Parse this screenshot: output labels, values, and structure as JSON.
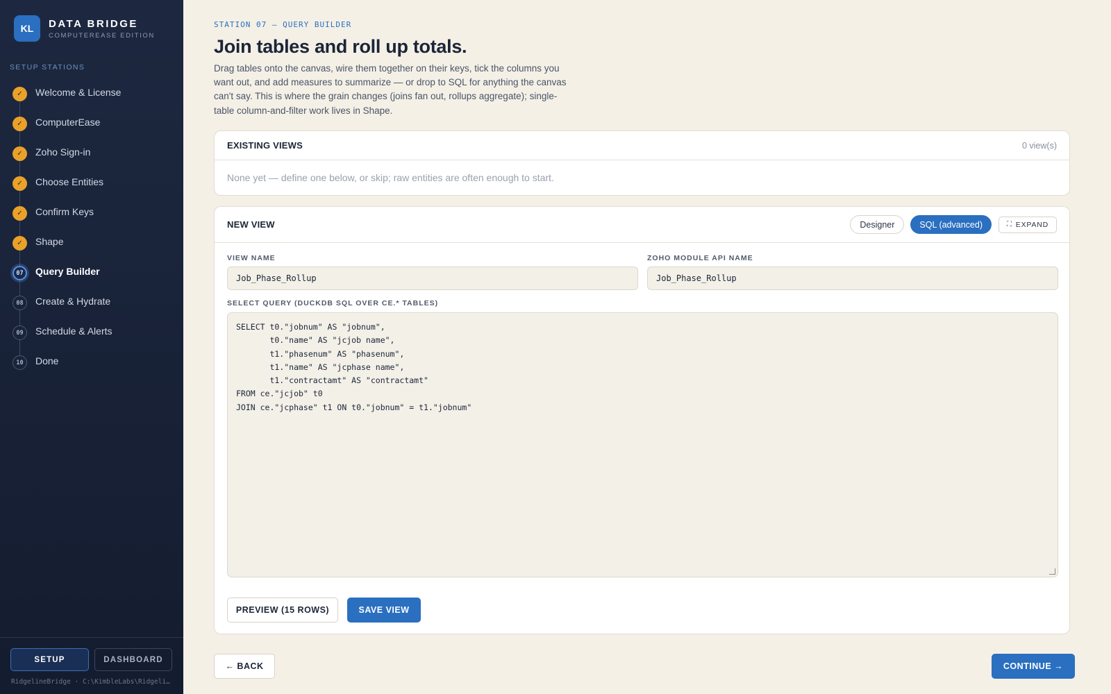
{
  "brand": {
    "initials": "KL",
    "title": "DATA BRIDGE",
    "subtitle": "COMPUTEREASE EDITION"
  },
  "sidebar": {
    "section_label": "SETUP STATIONS",
    "steps": [
      {
        "marker": "✓",
        "label": "Welcome & License",
        "state": "done"
      },
      {
        "marker": "✓",
        "label": "ComputerEase",
        "state": "done"
      },
      {
        "marker": "✓",
        "label": "Zoho Sign-in",
        "state": "done"
      },
      {
        "marker": "✓",
        "label": "Choose Entities",
        "state": "done"
      },
      {
        "marker": "✓",
        "label": "Confirm Keys",
        "state": "done"
      },
      {
        "marker": "✓",
        "label": "Shape",
        "state": "done"
      },
      {
        "marker": "07",
        "label": "Query Builder",
        "state": "active"
      },
      {
        "marker": "08",
        "label": "Create & Hydrate",
        "state": "todo"
      },
      {
        "marker": "09",
        "label": "Schedule & Alerts",
        "state": "todo"
      },
      {
        "marker": "10",
        "label": "Done",
        "state": "todo"
      }
    ],
    "mode_setup": "SETUP",
    "mode_dashboard": "DASHBOARD",
    "footer_path": "RidgelineBridge · C:\\KimbleLabs\\RidgelineBridge"
  },
  "header": {
    "eyebrow": "STATION 07 — QUERY BUILDER",
    "title": "Join tables and roll up totals.",
    "intro": "Drag tables onto the canvas, wire them together on their keys, tick the columns you want out, and add measures to summarize — or drop to SQL for anything the canvas can't say. This is where the grain changes (joins fan out, rollups aggregate); single-table column-and-filter work lives in Shape."
  },
  "existing_views": {
    "title": "EXISTING VIEWS",
    "count": "0 view(s)",
    "empty": "None yet — define one below, or skip; raw entities are often enough to start."
  },
  "new_view": {
    "title": "NEW VIEW",
    "designer_label": "Designer",
    "sql_label": "SQL (advanced)",
    "expand_label": "EXPAND",
    "view_name_label": "VIEW NAME",
    "view_name_value": "Job_Phase_Rollup",
    "api_name_label": "ZOHO MODULE API NAME",
    "api_name_value": "Job_Phase_Rollup",
    "query_label": "SELECT QUERY (DUCKDB SQL OVER CE.* TABLES)",
    "sql_lines": [
      "SELECT t0.\"jobnum\" AS \"jobnum\",",
      "       t0.\"name\" AS \"jcjob name\",",
      "       t1.\"phasenum\" AS \"phasenum\",",
      "       t1.\"name\" AS \"jcphase name\",",
      "       t1.\"contractamt\" AS \"contractamt\"",
      "FROM ce.\"jcjob\" t0",
      "JOIN ce.\"jcphase\" t1 ON t0.\"jobnum\" = t1.\"jobnum\""
    ],
    "preview_label": "PREVIEW (15 ROWS)",
    "save_label": "SAVE VIEW"
  },
  "nav": {
    "back_label": "← BACK",
    "continue_label": "CONTINUE →"
  },
  "colors": {
    "accent": "#2a6fc0",
    "done_step": "#e9a12a",
    "sidebar_bg": "#18213a",
    "page_bg": "#f4f0e6"
  }
}
